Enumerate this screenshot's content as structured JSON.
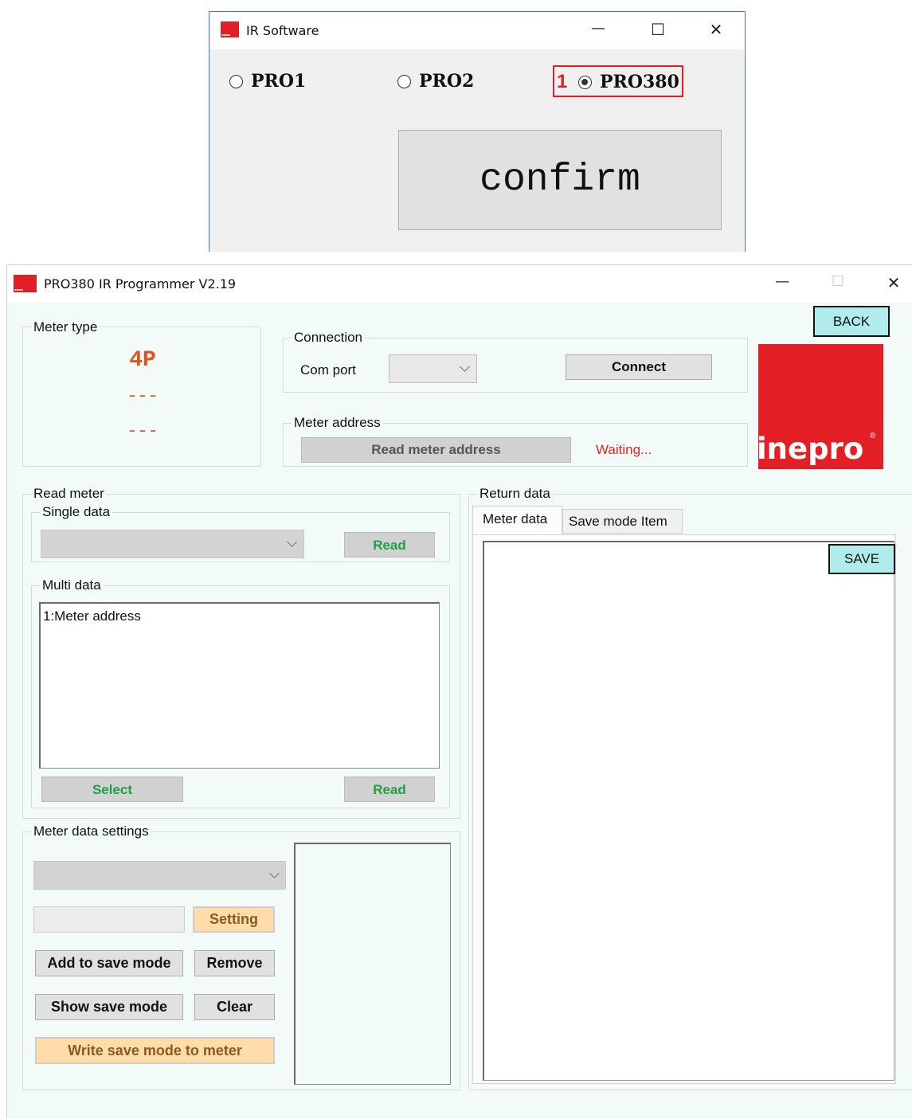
{
  "dialog": {
    "title": "IR Software",
    "controls": {
      "minimize": "—",
      "maximize": "☐",
      "close": "✕"
    },
    "options": [
      {
        "label": "PRO1",
        "selected": false
      },
      {
        "label": "PRO2",
        "selected": false
      },
      {
        "label": "PRO380",
        "selected": true
      }
    ],
    "annotation_number": "1",
    "confirm_label": "confirm"
  },
  "main": {
    "title": "PRO380 IR Programmer V2.19",
    "controls": {
      "minimize": "—",
      "maximize": "☐",
      "close": "✕"
    },
    "back_label": "BACK",
    "meter_type": {
      "label": "Meter type",
      "value": "4P",
      "line2": "---",
      "line3": "---"
    },
    "connection": {
      "label": "Connection",
      "com_port_label": "Com port",
      "com_port_value": "",
      "connect_label": "Connect"
    },
    "meter_address": {
      "label": "Meter address",
      "read_label": "Read meter address",
      "status": "Waiting..."
    },
    "brand": "inepro",
    "brand_reg": "®",
    "read_meter": {
      "label": "Read meter",
      "single": {
        "label": "Single data",
        "value": "",
        "read_label": "Read"
      },
      "multi": {
        "label": "Multi data",
        "items": [
          "1:Meter address"
        ],
        "select_label": "Select",
        "read_label": "Read"
      }
    },
    "settings": {
      "label": "Meter data settings",
      "setting_label": "Setting",
      "add_label": "Add to save mode",
      "remove_label": "Remove",
      "show_label": "Show save mode",
      "clear_label": "Clear",
      "write_label": "Write save mode to meter"
    },
    "return_data": {
      "label": "Return data",
      "tabs": [
        "Meter data",
        "Save mode Item"
      ],
      "save_label": "SAVE"
    }
  }
}
